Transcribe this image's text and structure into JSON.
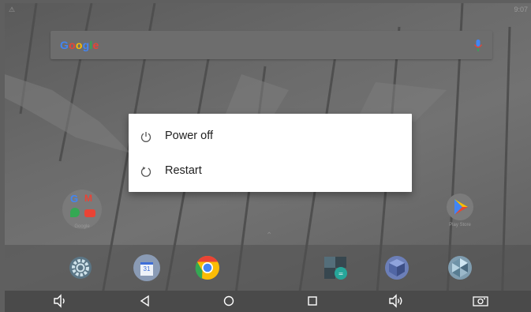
{
  "status_bar": {
    "left_text": "⚠  ",
    "right_text": "9:07"
  },
  "search": {
    "logo_text": "Google",
    "mic_icon": "mic-icon"
  },
  "power_dialog": {
    "items": [
      {
        "label": "Power off",
        "icon": "power-icon"
      },
      {
        "label": "Restart",
        "icon": "restart-icon"
      }
    ]
  },
  "home": {
    "folder_label": "Google",
    "play_label": "Play Store"
  },
  "dock": {
    "apps": [
      "settings-icon",
      "calendar-icon",
      "chrome-icon",
      "calculator-icon",
      "cube-icon",
      "photos-icon"
    ],
    "calendar_day": "31"
  },
  "nav_bar": {
    "buttons": [
      "volume-down-icon",
      "back-icon",
      "home-icon",
      "recents-icon",
      "volume-up-icon",
      "screenshot-icon"
    ]
  },
  "colors": {
    "google_blue": "#4285f4",
    "google_red": "#ea4335",
    "google_yellow": "#fbbc05",
    "google_green": "#34a853"
  }
}
